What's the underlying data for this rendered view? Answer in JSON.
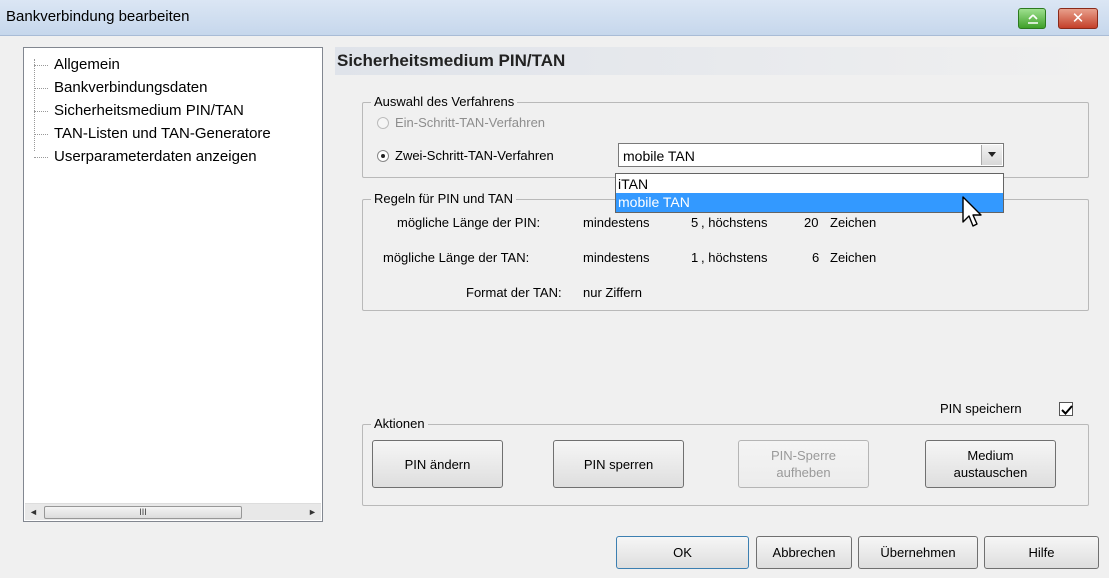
{
  "window": {
    "title": "Bankverbindung bearbeiten"
  },
  "tree": {
    "items": [
      {
        "label": "Allgemein"
      },
      {
        "label": "Bankverbindungsdaten"
      },
      {
        "label": "Sicherheitsmedium PIN/TAN"
      },
      {
        "label": "TAN-Listen und TAN-Generatore"
      },
      {
        "label": "Userparameterdaten anzeigen"
      }
    ],
    "scroll_thumb": "III",
    "scroll_left": "◄",
    "scroll_right": "►"
  },
  "panel": {
    "title": "Sicherheitsmedium PIN/TAN"
  },
  "verfahren": {
    "group_label": "Auswahl des Verfahrens",
    "option1": "Ein-Schritt-TAN-Verfahren",
    "option2": "Zwei-Schritt-TAN-Verfahren",
    "selected_value": "mobile TAN",
    "dropdown_options": [
      "iTAN",
      "mobile TAN"
    ],
    "highlighted_option": "mobile TAN"
  },
  "regeln": {
    "group_label": "Regeln für PIN und TAN",
    "pin_label": "mögliche Länge der PIN:",
    "pin_min_label": "mindestens",
    "pin_min": "5",
    "pin_max_label": ", höchstens",
    "pin_max": "20",
    "pin_unit": "Zeichen",
    "tan_label": "mögliche Länge der TAN:",
    "tan_min_label": "mindestens",
    "tan_min": "1",
    "tan_max_label": ", höchstens",
    "tan_max": "6",
    "tan_unit": "Zeichen",
    "format_label": "Format der TAN:",
    "format_value": "nur Ziffern"
  },
  "pin_speichern": {
    "label": "PIN speichern",
    "checked": true
  },
  "aktionen": {
    "group_label": "Aktionen",
    "pin_aendern": "PIN ändern",
    "pin_sperren": "PIN sperren",
    "pin_sperre_aufheben": "PIN-Sperre\naufheben",
    "medium_austauschen": "Medium\naustauschen"
  },
  "footer": {
    "ok": "OK",
    "abbrechen": "Abbrechen",
    "uebernehmen": "Übernehmen",
    "hilfe": "Hilfe"
  }
}
